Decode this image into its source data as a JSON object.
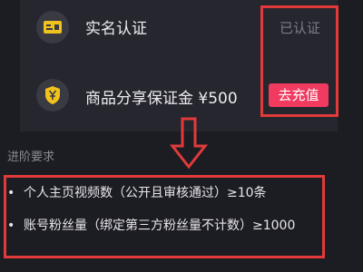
{
  "verification": {
    "icon": "id-card-icon",
    "label": "实名认证",
    "status": "已认证"
  },
  "deposit": {
    "icon": "yen-shield-icon",
    "label": "商品分享保证金 ¥500",
    "button_label": "去充值"
  },
  "requirements": {
    "title": "进阶要求",
    "items": [
      {
        "bullet": "•",
        "text": "个人主页视频数（公开且审核通过）≥10条"
      },
      {
        "bullet": "•",
        "text": "账号粉丝量（绑定第三方粉丝量不计数）≥1000"
      }
    ]
  },
  "colors": {
    "background": "#1c1c23",
    "card": "#26262e",
    "accent": "#f03a5f",
    "icon_yellow": "#f1c21b",
    "annotation": "#e23a3a"
  }
}
